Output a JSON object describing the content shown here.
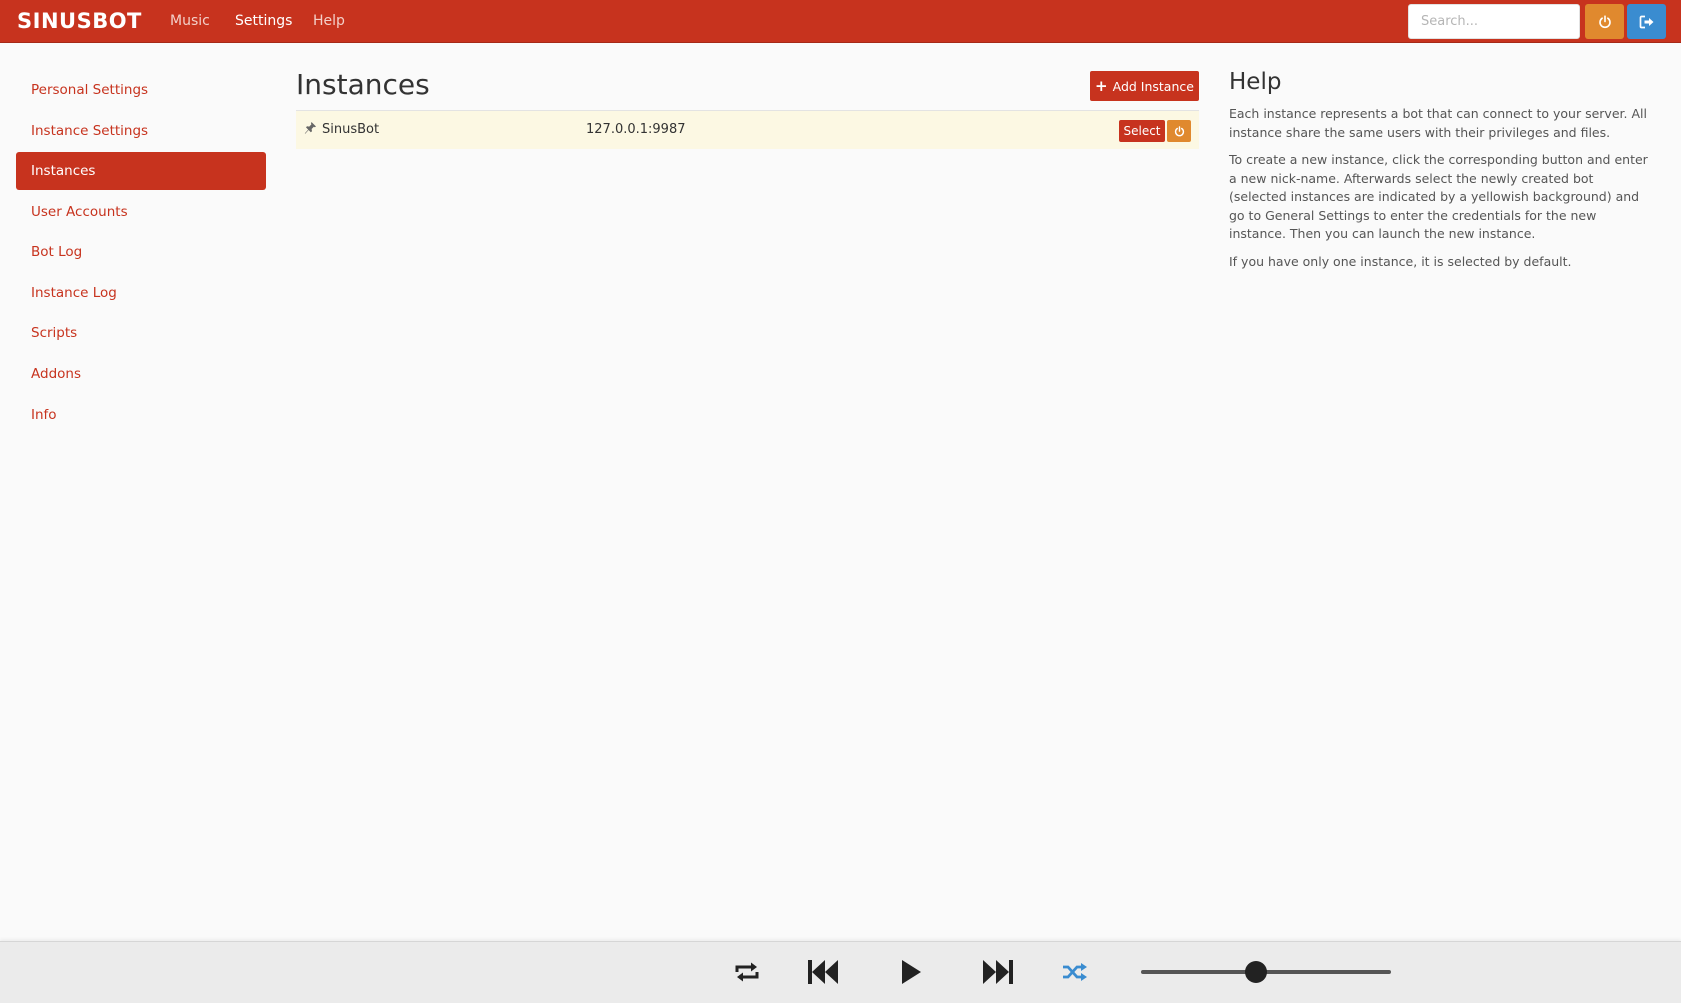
{
  "brand": "SINUSBOT",
  "nav": {
    "links": [
      "Music",
      "Settings",
      "Help"
    ],
    "active": "Settings",
    "search_placeholder": "Search..."
  },
  "sidebar": {
    "items": [
      {
        "label": "Personal Settings"
      },
      {
        "label": "Instance Settings"
      },
      {
        "label": "Instances"
      },
      {
        "label": "User Accounts"
      },
      {
        "label": "Bot Log"
      },
      {
        "label": "Instance Log"
      },
      {
        "label": "Scripts"
      },
      {
        "label": "Addons"
      },
      {
        "label": "Info"
      }
    ],
    "active": "Instances"
  },
  "main": {
    "title": "Instances",
    "add_button": "Add Instance",
    "instances": [
      {
        "name": "SinusBot",
        "address": "127.0.0.1:9987",
        "select_label": "Select",
        "selected": true
      }
    ]
  },
  "help": {
    "title": "Help",
    "paragraphs": [
      "Each instance represents a bot that can connect to your server. All instance share the same users with their privileges and files.",
      "To create a new instance, click the corresponding button and enter a new nick-name. Afterwards select the newly created bot (selected instances are indicated by a yellowish background) and go to General Settings to enter the credentials for the new instance. Then you can launch the new instance.",
      "If you have only one instance, it is selected by default."
    ]
  },
  "player": {
    "volume_fraction": 0.46,
    "shuffle_active": true
  },
  "colors": {
    "brand_red": "#c7331e",
    "orange": "#e0892e",
    "blue": "#3a8cd0",
    "selected_row": "#fcf8e3"
  }
}
